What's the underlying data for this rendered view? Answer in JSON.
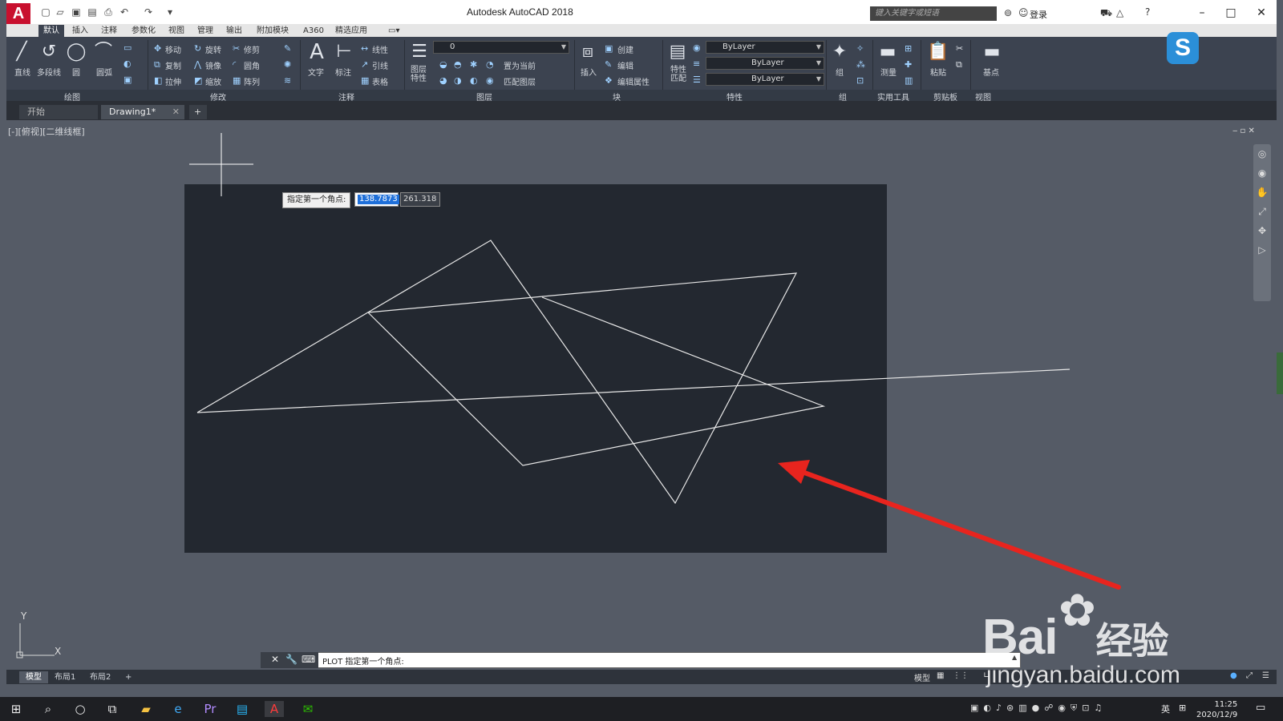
{
  "app": {
    "title": "Autodesk AutoCAD 2018",
    "logo": "A"
  },
  "search": {
    "placeholder": "键入关键字或短语"
  },
  "account": {
    "login": "登录"
  },
  "menu_tabs": [
    "默认",
    "插入",
    "注释",
    "参数化",
    "视图",
    "管理",
    "输出",
    "附加模块",
    "A360",
    "精选应用"
  ],
  "ribbon": {
    "draw": {
      "line": "直线",
      "polyline": "多段线",
      "circle": "圆",
      "arc": "圆弧",
      "panel": "绘图"
    },
    "modify": {
      "move": "移动",
      "rotate": "旋转",
      "trim": "修剪",
      "copy": "复制",
      "mirror": "镜像",
      "fillet": "圆角",
      "stretch": "拉伸",
      "scale": "缩放",
      "array": "阵列",
      "panel": "修改"
    },
    "annotation": {
      "text": "文字",
      "dimension": "标注",
      "linear": "线性",
      "leader": "引线",
      "table": "表格",
      "panel": "注释"
    },
    "layers": {
      "properties": "图层特性",
      "current_layer": "0",
      "make_current": "置为当前",
      "match_layer": "匹配图层",
      "panel": "图层"
    },
    "block": {
      "insert": "插入",
      "create": "创建",
      "edit": "编辑",
      "edit_attributes": "编辑属性",
      "panel": "块"
    },
    "properties": {
      "match": "特性匹配",
      "color": "ByLayer",
      "linetype": "ByLayer",
      "lineweight": "ByLayer",
      "panel": "特性"
    },
    "groups": {
      "group": "组",
      "panel": "组"
    },
    "utilities": {
      "measure": "测量",
      "panel": "实用工具"
    },
    "clipboard": {
      "paste": "粘贴",
      "panel": "剪贴板"
    },
    "view": {
      "base": "基点",
      "panel": "视图"
    }
  },
  "file_tabs": {
    "start": "开始",
    "drawing": "Drawing1*",
    "add": "+"
  },
  "viewport": {
    "label": "[-][俯视][二维线框]"
  },
  "prompt": {
    "label": "指定第一个角点:",
    "x_value": "138.7873",
    "y_value": "261.318"
  },
  "ucs": {
    "x": "X",
    "y": "Y"
  },
  "command_line": {
    "text": "PLOT 指定第一个角点:"
  },
  "layout_tabs": [
    "模型",
    "布局1",
    "布局2",
    "+"
  ],
  "status": {
    "model": "模型"
  },
  "clock": {
    "time": "11:25",
    "date": "2020/12/9"
  },
  "tray": {
    "ime": "英"
  },
  "watermark": {
    "brand": "Bai",
    "suffix": "经验",
    "url": "jingyan.baidu.com"
  },
  "colors": {
    "ribbon": "#3c4350",
    "canvas": "#555b66",
    "plot_area": "#232830",
    "arrow": "#e8241e",
    "accent": "#1e6fd9"
  }
}
